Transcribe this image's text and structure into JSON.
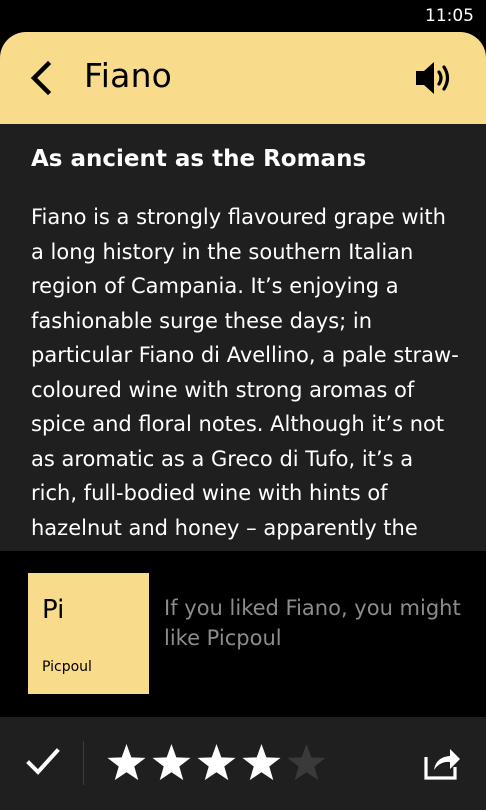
{
  "status_bar": {
    "time": "11:05"
  },
  "header": {
    "title": "Fiano",
    "back_icon": "chevron-left-icon",
    "speaker_icon": "speaker-volume-icon",
    "accent_color": "#f8dc8c"
  },
  "content": {
    "heading": "As ancient as the Romans",
    "body": "Fiano is a strongly flavoured grape with a long history in the southern Italian region of Campania. It’s enjoying a fashionable surge these days; in particular Fiano di Avellino, a pale straw-coloured wine with strong aromas of spice and floral notes. Although it’s not as aromatic as a Greco di Tufo, it’s a rich, full-bodied wine with hints of hazelnut and honey – apparently the vines are a favourite"
  },
  "recommendation": {
    "tile_abbr": "Pi",
    "tile_name": "Picpoul",
    "text": "If you liked Fiano, you might like Picpoul"
  },
  "bottom_bar": {
    "check_icon": "checkmark-icon",
    "share_icon": "share-icon",
    "rating": 4,
    "rating_max": 5
  }
}
